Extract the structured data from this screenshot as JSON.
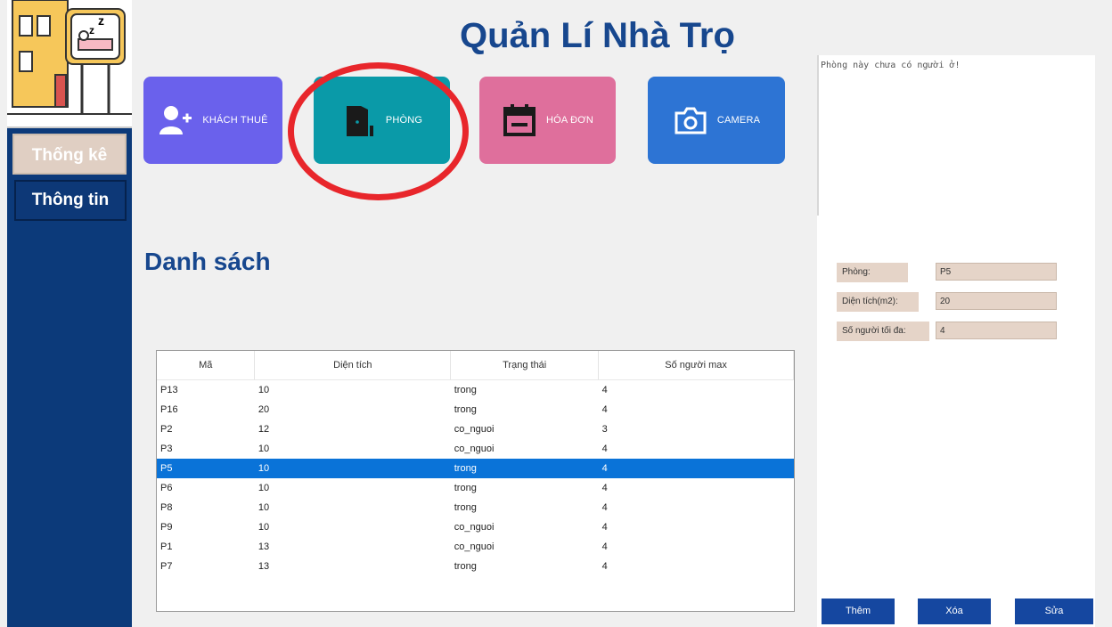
{
  "header": {
    "title": "Quản Lí Nhà Trọ"
  },
  "sidebar": {
    "items": [
      {
        "label": "Thống kê"
      },
      {
        "label": "Thông tin"
      }
    ]
  },
  "nav": {
    "buttons": [
      {
        "label": "KHÁCH THUÊ",
        "icon": "add-user-icon",
        "color": "#6a61ec"
      },
      {
        "label": "PHÒNG",
        "icon": "door-icon",
        "color": "#0a9aa8"
      },
      {
        "label": "HÓA ĐƠN",
        "icon": "calendar-icon",
        "color": "#df6f9c"
      },
      {
        "label": "CAMERA",
        "icon": "camera-icon",
        "color": "#2d74d4"
      }
    ]
  },
  "main": {
    "section_title": "Danh sách",
    "table": {
      "columns": [
        "Mã",
        "Diện tích",
        "Trạng thái",
        "Số người max"
      ],
      "rows": [
        [
          "P13",
          "10",
          "trong",
          "4"
        ],
        [
          "P16",
          "20",
          "trong",
          "4"
        ],
        [
          "P2",
          "12",
          "co_nguoi",
          "3"
        ],
        [
          "P3",
          "10",
          "co_nguoi",
          "4"
        ],
        [
          "P5",
          "10",
          "trong",
          "4"
        ],
        [
          "P6",
          "10",
          "trong",
          "4"
        ],
        [
          "P8",
          "10",
          "trong",
          "4"
        ],
        [
          "P9",
          "10",
          "co_nguoi",
          "4"
        ],
        [
          "P1",
          "13",
          "co_nguoi",
          "4"
        ],
        [
          "P7",
          "13",
          "trong",
          "4"
        ]
      ],
      "selected_row": "P5"
    }
  },
  "panel": {
    "message": "Phòng này chưa có người ở!",
    "fields": [
      {
        "label": "Phòng:",
        "value": "P5"
      },
      {
        "label": "Diện tích(m2):",
        "value": "20"
      },
      {
        "label": "Số người tối đa:",
        "value": "4"
      }
    ],
    "buttons": {
      "add": "Thêm",
      "delete": "Xóa",
      "edit": "Sửa"
    }
  },
  "colors": {
    "accent": "#17478e",
    "sidebar": "#0c3a7a",
    "highlight": "#e8262b",
    "selection": "#0a73d8"
  }
}
